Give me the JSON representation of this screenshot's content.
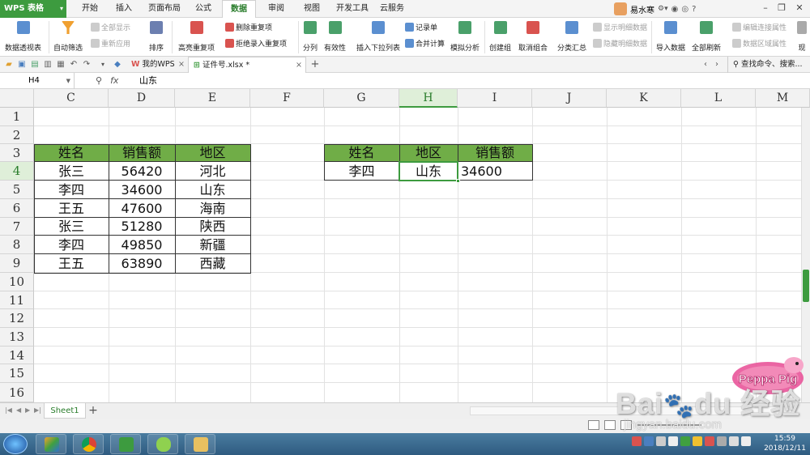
{
  "app": {
    "name": "WPS 表格",
    "menu_tabs": [
      "开始",
      "插入",
      "页面布局",
      "公式",
      "数据",
      "审阅",
      "视图",
      "开发工具",
      "云服务"
    ],
    "active_tab": "数据",
    "user_name": "易水寒"
  },
  "ribbon": {
    "pivot": "数据透视表",
    "autofilter": "自动筛选",
    "show_all": "全部显示",
    "reapply": "重新应用",
    "sort": "排序",
    "highlight_dup": "高亮重复项",
    "delete_dup": "删除重复项",
    "reject_dup": "拒绝录入重复项",
    "split": "分列",
    "validity": "有效性",
    "insert_dropdown": "插入下拉列表",
    "record_form": "记录单",
    "consolidate": "合并计算",
    "what_if": "模拟分析",
    "create_group": "创建组",
    "ungroup": "取消组合",
    "subtotal": "分类汇总",
    "show_detail": "显示明细数据",
    "hide_detail": "隐藏明细数据",
    "import": "导入数据",
    "refresh_all": "全部刷新",
    "edit_conn": "编辑连接属性",
    "data_range_props": "数据区域属性",
    "current": "现"
  },
  "quickbar": {
    "my_wps": "我的WPS",
    "file_tab": "证件号.xlsx *",
    "search": "查找命令、搜索..."
  },
  "formula": {
    "name_box": "H4",
    "fx": "fx",
    "content": "山东"
  },
  "columns": [
    "C",
    "D",
    "E",
    "F",
    "G",
    "H",
    "I",
    "J",
    "K",
    "L",
    "M"
  ],
  "rows": [
    "1",
    "2",
    "3",
    "4",
    "5",
    "6",
    "7",
    "8",
    "9",
    "10",
    "11",
    "12",
    "13",
    "14",
    "15",
    "16"
  ],
  "table1": {
    "headers": [
      "姓名",
      "销售额",
      "地区"
    ],
    "rows": [
      [
        "张三",
        "56420",
        "河北"
      ],
      [
        "李四",
        "34600",
        "山东"
      ],
      [
        "王五",
        "47600",
        "海南"
      ],
      [
        "张三",
        "51280",
        "陕西"
      ],
      [
        "李四",
        "49850",
        "新疆"
      ],
      [
        "王五",
        "63890",
        "西藏"
      ]
    ]
  },
  "table2": {
    "headers": [
      "姓名",
      "地区",
      "销售额"
    ],
    "row": [
      "李四",
      "山东",
      "34600"
    ]
  },
  "sheet_tab": "Sheet1",
  "taskbar": {
    "time": "15:59",
    "date": "2018/12/11"
  },
  "watermark": {
    "site": "jingyan.baidu.com"
  },
  "colors": {
    "accent": "#3d9b3f",
    "header_fill": "#70ad47",
    "selected_col": "#dfefd9"
  }
}
